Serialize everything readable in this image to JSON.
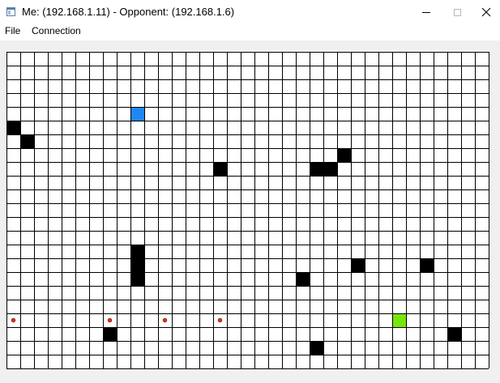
{
  "window": {
    "title": "Me: (192.168.1.11) - Opponent: (192.168.1.6)",
    "icon": "app-window-icon",
    "controls": {
      "minimize_icon": "minimize-icon",
      "maximize_icon": "maximize-icon",
      "close_icon": "close-icon"
    }
  },
  "menu": {
    "items": [
      {
        "label": "File"
      },
      {
        "label": "Connection"
      }
    ]
  },
  "board": {
    "cols": 35,
    "rows": 23,
    "colors": {
      "background": "#ffffff",
      "grid": "#000000",
      "wall": "#000000",
      "me": "#1e88f0",
      "opponent": "#78e60a",
      "bullet": "#e03010"
    },
    "walls": [
      [
        0,
        5
      ],
      [
        1,
        6
      ],
      [
        9,
        14
      ],
      [
        9,
        15
      ],
      [
        9,
        16
      ],
      [
        7,
        20
      ],
      [
        15,
        8
      ],
      [
        21,
        16
      ],
      [
        22,
        8
      ],
      [
        23,
        8
      ],
      [
        24,
        7
      ],
      [
        22,
        21
      ],
      [
        25,
        15
      ],
      [
        30,
        15
      ],
      [
        32,
        20
      ]
    ],
    "me": [
      9,
      4
    ],
    "opponent": [
      28,
      19
    ],
    "bullets": [
      [
        0,
        19
      ],
      [
        7,
        19
      ],
      [
        11,
        19
      ],
      [
        15,
        19
      ]
    ]
  }
}
